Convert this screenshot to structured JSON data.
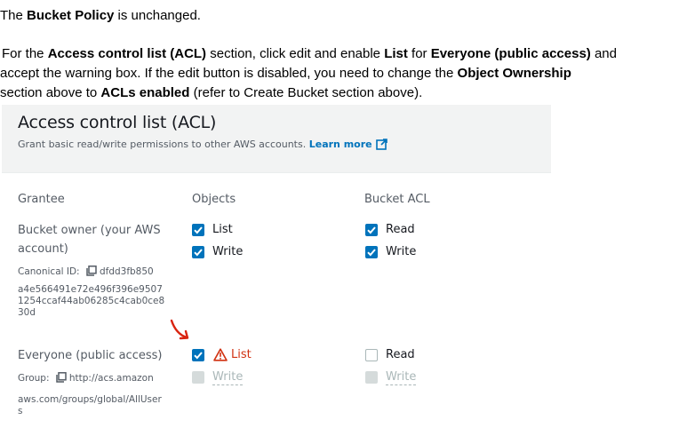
{
  "intro": {
    "p1_pre": "The ",
    "p1_bold": "Bucket Policy",
    "p1_post": " is unchanged.",
    "p2_l1_a": "For the ",
    "p2_l1_b": "Access control list (ACL)",
    "p2_l1_c": " section, click edit and enable ",
    "p2_l1_d": "List",
    "p2_l1_e": " for ",
    "p2_l1_f": "Everyone (public access)",
    "p2_l1_g": " and",
    "p2_l2_a": "accept the warning box. If the edit button is disabled, you need to change the ",
    "p2_l2_b": "Object Ownership",
    "p2_l3_a": "section above to ",
    "p2_l3_b": "ACLs enabled",
    "p2_l3_c": " (refer to Create Bucket section above)."
  },
  "acl": {
    "title": "Access control list (ACL)",
    "description": "Grant basic read/write permissions to other AWS accounts.",
    "learn_more": "Learn more",
    "columns": {
      "grantee": "Grantee",
      "objects": "Objects",
      "bucket_acl": "Bucket ACL"
    },
    "owner": {
      "name_line1": "Bucket owner (your AWS",
      "name_line2": "account)",
      "canonical_label": "Canonical ID:",
      "canonical_part1": "dfdd3fb850",
      "canonical_line2": "a4e566491e72e496f396e9507",
      "canonical_line3": "1254ccaf44ab06285c4cab0ce8",
      "canonical_line4": "30d",
      "objects_list": "List",
      "objects_write": "Write",
      "bucket_read": "Read",
      "bucket_write": "Write"
    },
    "everyone": {
      "name": "Everyone (public access)",
      "group_label": "Group:",
      "group_part1": "http://acs.amazon",
      "group_line2": "aws.com/groups/global/AllUser",
      "group_line3": "s",
      "objects_list": "List",
      "objects_write": "Write",
      "bucket_read": "Read",
      "bucket_write": "Write"
    },
    "colors": {
      "checkbox": "#0073bb",
      "warning": "#d13212",
      "annotation_arrow": "#d9230f"
    }
  }
}
